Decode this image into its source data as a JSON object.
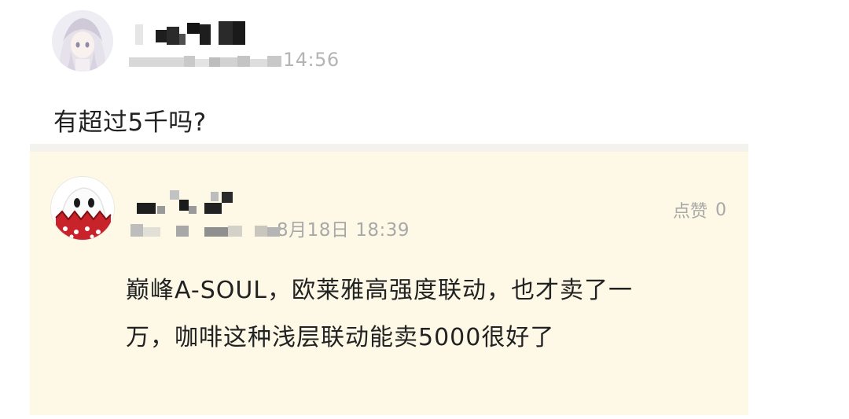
{
  "comment": {
    "time_partial": "14:56",
    "text": "有超过5千吗?"
  },
  "reply": {
    "time_partial": "8月18日 18:39",
    "like_label": "点赞",
    "like_count": "0",
    "text_line1": "巅峰A-SOUL，欧莱雅高强度联动，也才卖了一",
    "text_line2": "万，咖啡这种浅层联动能卖5000很好了"
  }
}
